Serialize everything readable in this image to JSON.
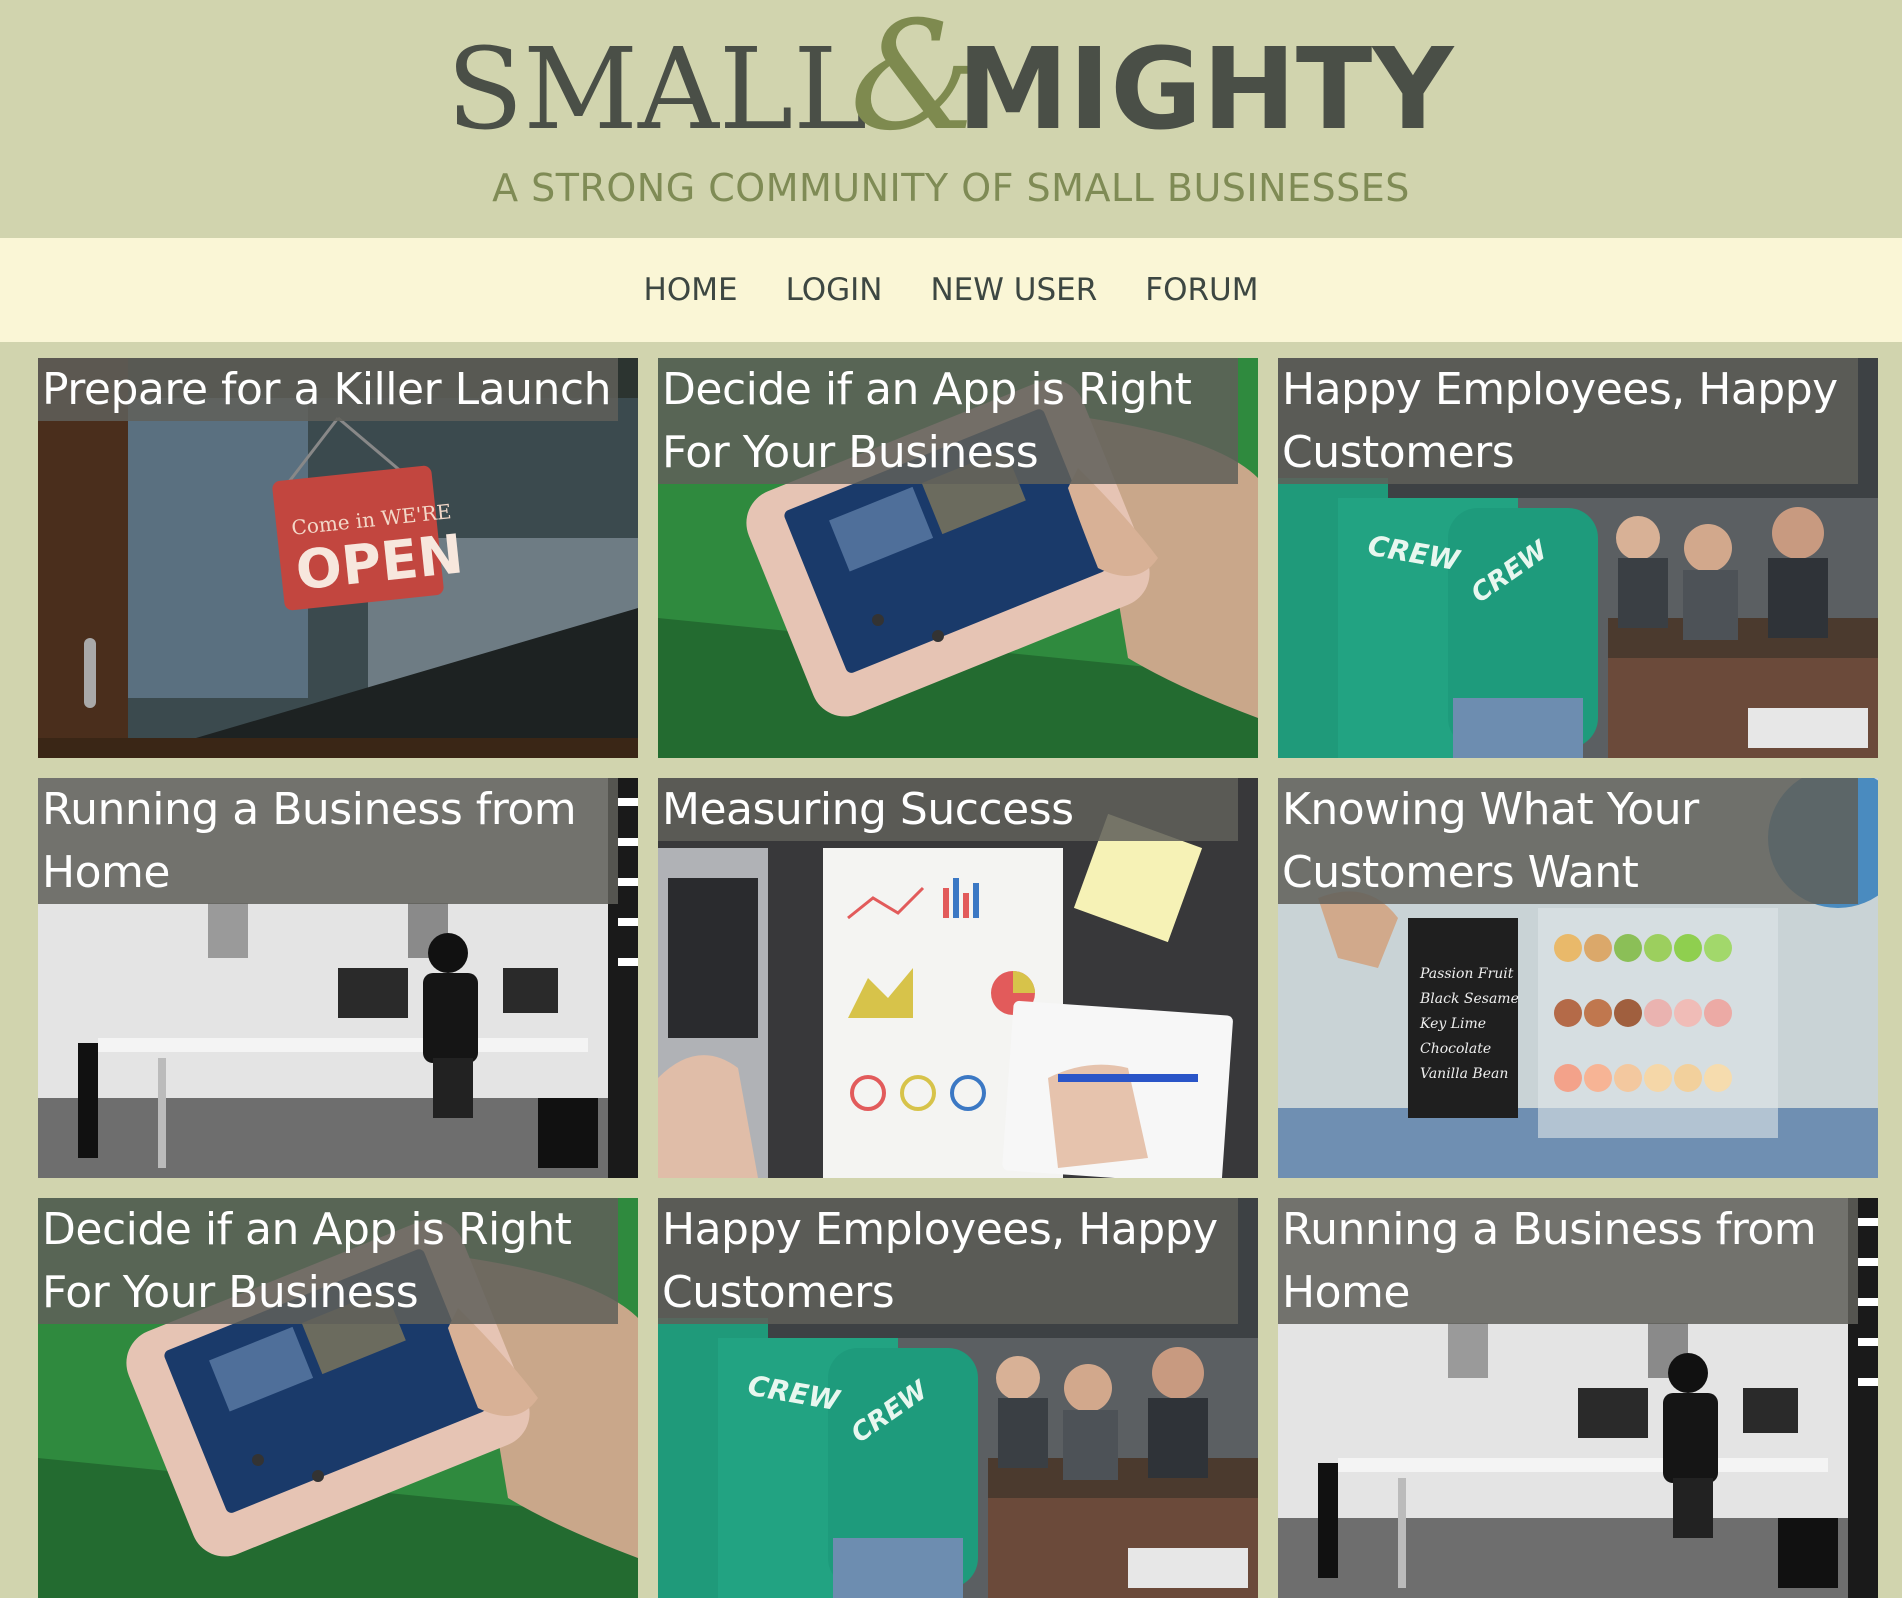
{
  "site": {
    "logo_text": "SMALL&MIGHTY",
    "tagline": "A STRONG COMMUNITY OF SMALL BUSINESSES"
  },
  "colors": {
    "page_background": "#d1d4ae",
    "nav_background": "#faf6d6",
    "tagline": "#7f8b55",
    "logo_text": "#4a4f47",
    "logo_ampersand": "#7e8a4f",
    "card_title_overlay": "#5f5f5a"
  },
  "nav": {
    "items": [
      {
        "label": "HOME"
      },
      {
        "label": "LOGIN"
      },
      {
        "label": "NEW USER"
      },
      {
        "label": "FORUM"
      }
    ]
  },
  "cards": [
    {
      "title": "Prepare for a Killer Launch",
      "image": "open-sign-photo"
    },
    {
      "title": "Decide if an App is Right For Your Business",
      "image": "smartphone-in-hand-photo"
    },
    {
      "title": "Happy Employees, Happy Customers",
      "image": "crew-staff-serving-photo"
    },
    {
      "title": "Running a Business from Home",
      "image": "home-office-desk-photo"
    },
    {
      "title": "Measuring Success",
      "image": "charts-on-desk-photo"
    },
    {
      "title": "Knowing What Your Customers Want",
      "image": "macaron-display-photo"
    },
    {
      "title": "Decide if an App is Right For Your Business",
      "image": "smartphone-in-hand-photo"
    },
    {
      "title": "Happy Employees, Happy Customers",
      "image": "crew-staff-serving-photo"
    },
    {
      "title": "Running a Business from Home",
      "image": "home-office-desk-photo"
    }
  ]
}
